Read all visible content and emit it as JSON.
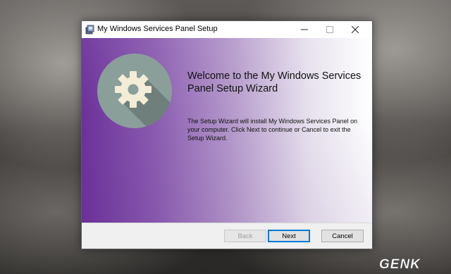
{
  "window": {
    "title": "My Windows Services Panel Setup",
    "minimize_icon": "minimize-icon",
    "maximize_icon": "maximize-icon",
    "close_icon": "close-icon"
  },
  "wizard": {
    "heading": "Welcome to the My Windows Services Panel Setup Wizard",
    "description": "The Setup Wizard will install My Windows Services Panel on your computer. Click Next to continue or Cancel to exit the Setup Wizard.",
    "logo_icon": "gear-icon"
  },
  "buttons": {
    "back": "Back",
    "next": "Next",
    "cancel": "Cancel"
  },
  "watermark": {
    "text": "GENK"
  },
  "colors": {
    "banner_start": "#6c329b",
    "banner_end": "#ffffff",
    "logo_circle": "#8a9e9a",
    "gear": "#f3ecd6",
    "focus_border": "#0078d7"
  }
}
